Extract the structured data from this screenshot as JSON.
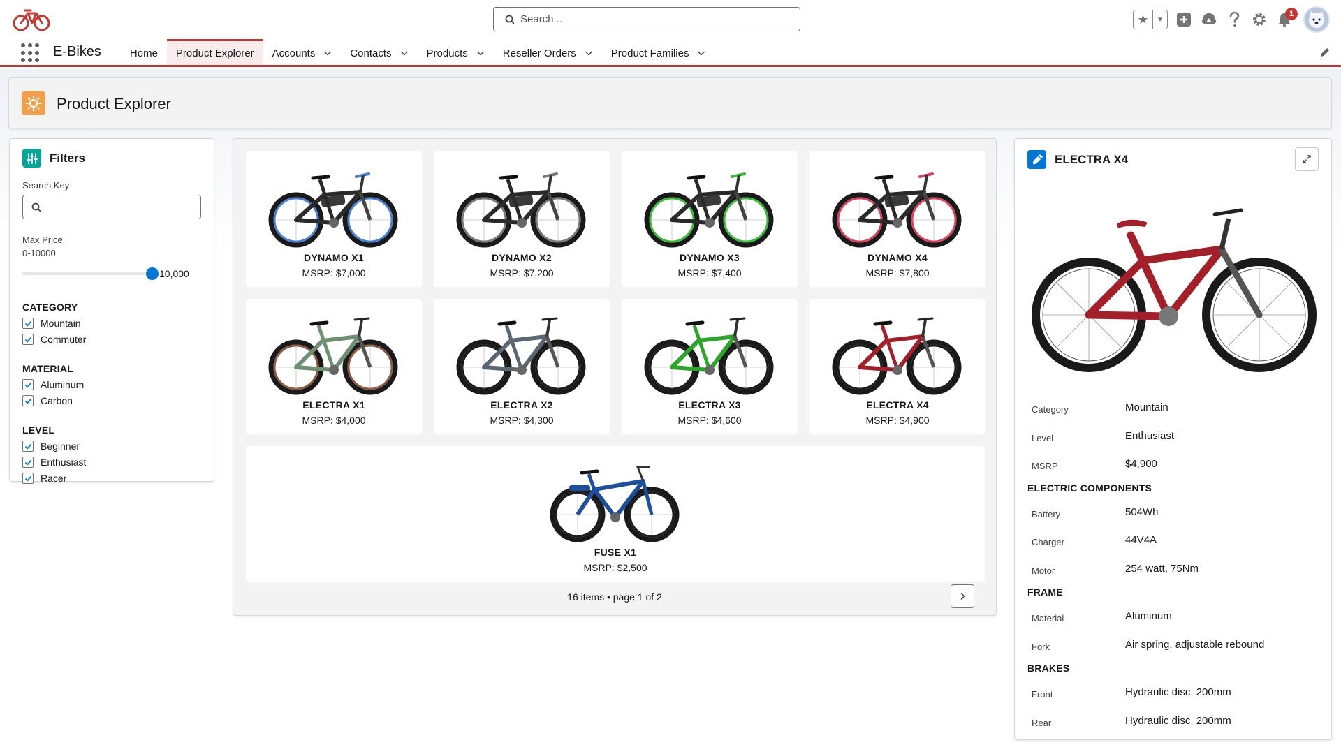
{
  "colors": {
    "brand": "#c23934",
    "accent": "#0176d3",
    "teal": "#06a59a",
    "orange": "#f0a04b"
  },
  "header": {
    "search_placeholder": "Search...",
    "notification_count": "1",
    "icons": [
      "favorites-star-icon",
      "add-icon",
      "trailhead-icon",
      "help-icon",
      "settings-gear-icon",
      "notification-bell-icon"
    ]
  },
  "nav": {
    "app_name": "E-Bikes",
    "items": [
      {
        "label": "Home"
      },
      {
        "label": "Product Explorer"
      },
      {
        "label": "Accounts"
      },
      {
        "label": "Contacts"
      },
      {
        "label": "Products"
      },
      {
        "label": "Reseller Orders"
      },
      {
        "label": "Product Families"
      }
    ]
  },
  "page": {
    "title": "Product Explorer"
  },
  "filters": {
    "title": "Filters",
    "search_label": "Search Key",
    "search_value": "",
    "max_price_label": "Max Price",
    "max_price_range": "0-10000",
    "max_price_value": "10,000",
    "max_price_fraction": 1.0,
    "groups": [
      {
        "title": "CATEGORY",
        "options": [
          {
            "label": "Mountain",
            "checked": true
          },
          {
            "label": "Commuter",
            "checked": true
          }
        ]
      },
      {
        "title": "MATERIAL",
        "options": [
          {
            "label": "Aluminum",
            "checked": true
          },
          {
            "label": "Carbon",
            "checked": true
          }
        ]
      },
      {
        "title": "LEVEL",
        "options": [
          {
            "label": "Beginner",
            "checked": true
          },
          {
            "label": "Enthusiast",
            "checked": true
          },
          {
            "label": "Racer",
            "checked": true
          }
        ]
      }
    ]
  },
  "products": {
    "items": [
      {
        "name": "DYNAMO X1",
        "price": "MSRP: $7,000",
        "accent": "#4a7fd4"
      },
      {
        "name": "DYNAMO X2",
        "price": "MSRP: $7,200",
        "accent": "#7a7a7a"
      },
      {
        "name": "DYNAMO X3",
        "price": "MSRP: $7,400",
        "accent": "#3dbb3d"
      },
      {
        "name": "DYNAMO X4",
        "price": "MSRP: $7,800",
        "accent": "#d8435e"
      },
      {
        "name": "ELECTRA X1",
        "price": "MSRP: $4,000",
        "accent": "#6f8f72"
      },
      {
        "name": "ELECTRA X2",
        "price": "MSRP: $4,300",
        "accent": "#5b6670"
      },
      {
        "name": "ELECTRA X3",
        "price": "MSRP: $4,600",
        "accent": "#2da52d"
      },
      {
        "name": "ELECTRA X4",
        "price": "MSRP: $4,900",
        "accent": "#a3202a"
      },
      {
        "name": "FUSE X1",
        "price": "MSRP: $2,500",
        "accent": "#1d4f9c"
      }
    ],
    "pager": "16 items • page 1 of 2"
  },
  "detail": {
    "title": "ELECTRA X4",
    "rows": [
      {
        "label": "Category",
        "value": "Mountain"
      },
      {
        "label": "Level",
        "value": "Enthusiast"
      },
      {
        "label": "MSRP",
        "value": "$4,900"
      }
    ],
    "sections": [
      {
        "title": "ELECTRIC COMPONENTS",
        "rows": [
          {
            "label": "Battery",
            "value": "504Wh"
          },
          {
            "label": "Charger",
            "value": "44V4A"
          },
          {
            "label": "Motor",
            "value": "254 watt, 75Nm"
          }
        ]
      },
      {
        "title": "FRAME",
        "rows": [
          {
            "label": "Material",
            "value": "Aluminum"
          },
          {
            "label": "Fork",
            "value": "Air spring, adjustable rebound"
          }
        ]
      },
      {
        "title": "BRAKES",
        "rows": [
          {
            "label": "Front",
            "value": "Hydraulic disc, 200mm"
          },
          {
            "label": "Rear",
            "value": "Hydraulic disc, 200mm"
          }
        ]
      }
    ]
  }
}
